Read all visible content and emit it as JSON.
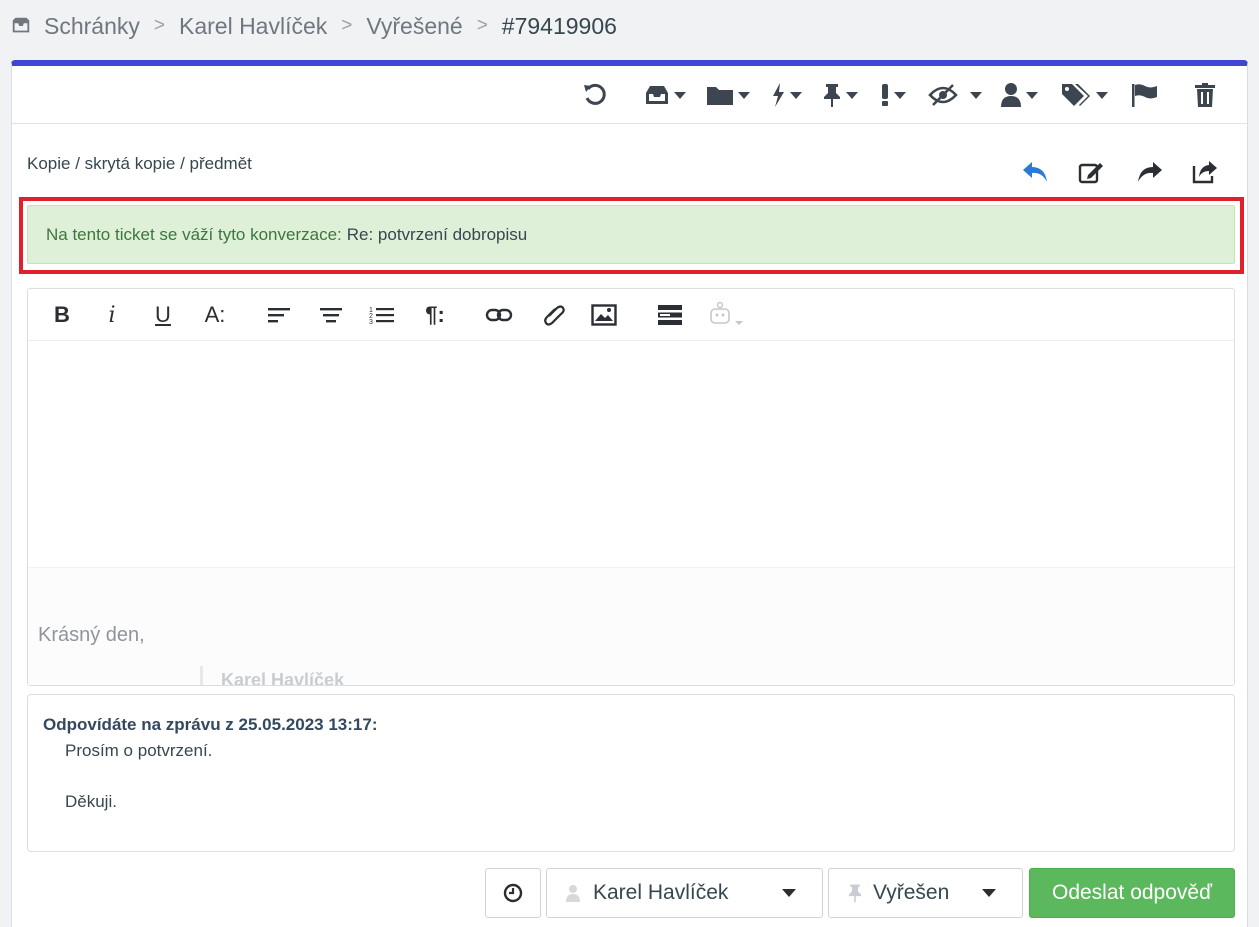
{
  "breadcrumb": {
    "root": "Schránky",
    "owner": "Karel Havlíček",
    "folder": "Vyřešené",
    "ticket": "#79419906",
    "separator": ">"
  },
  "toolbar": {
    "icons": [
      "refresh-icon",
      "inbox-icon",
      "folder-icon",
      "bolt-icon",
      "pin-icon",
      "exclamation-icon",
      "eye-slash-icon",
      "user-icon",
      "tags-icon",
      "flag-icon",
      "trash-icon"
    ]
  },
  "compose": {
    "cc_link": "Kopie / skrytá kopie / předmět",
    "actions": [
      "reply-icon",
      "edit-icon",
      "forward-icon",
      "share-icon"
    ]
  },
  "alert": {
    "text": "Na tento ticket se váží tyto konverzace:",
    "subject": "Re: potvrzení dobropisu"
  },
  "editor": {
    "tools": [
      "bold-icon",
      "italic-icon",
      "underline-icon",
      "font-size-icon",
      "align-left-icon",
      "align-center-icon",
      "ordered-list-icon",
      "paragraph-icon",
      "link-icon",
      "attachment-icon",
      "image-icon",
      "template-icon",
      "robot-icon"
    ],
    "bold": "B",
    "italic": "i",
    "underline": "U",
    "font_size": "A:",
    "paragraph": "¶:",
    "signature_greeting": "Krásný den,",
    "signature_name": "Karel Havlíček"
  },
  "reply": {
    "title": "Odpovídáte na zprávu z 25.05.2023 13:17:",
    "line1": "Prosím o potvrzení.",
    "line2": "Děkuji."
  },
  "footer": {
    "assignee": "Karel Havlíček",
    "status": "Vyřešen",
    "send_label": "Odeslat odpověď"
  },
  "colors": {
    "accent": "#3f46d3",
    "alert_bg": "#dff0d8",
    "alert_text": "#3c763d",
    "highlight": "#e0202a",
    "send": "#5cb85c",
    "reply_icon": "#2b7bd6"
  }
}
